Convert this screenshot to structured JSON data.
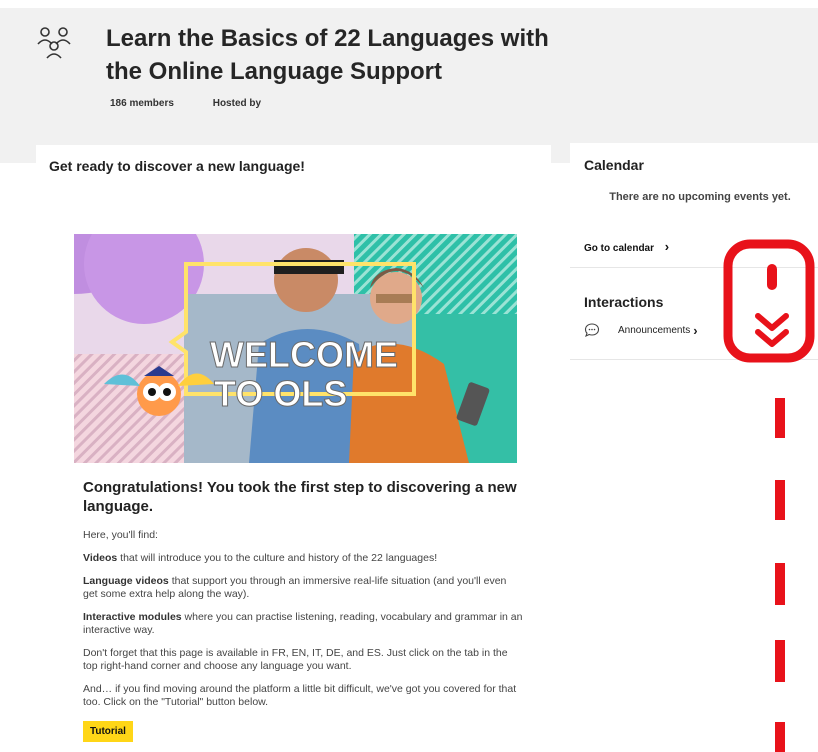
{
  "group": {
    "title": "Learn the Basics of 22 Languages with the Online Language Support",
    "members": "186 members",
    "hosted_by": "Hosted by"
  },
  "main": {
    "title": "Get ready to discover a new language!",
    "banner_text_line1": "WELCOME",
    "banner_text_line2": "TO OLS",
    "heading": "Congratulations! You took the first step to discovering a new language.",
    "intro": "Here, you'll find:",
    "items": [
      {
        "bold": "Videos",
        "text": " that will introduce you to the culture and history of the 22 languages!"
      },
      {
        "bold": "Language videos",
        "text": " that support you through an immersive real-life situation (and you'll even get some extra help along the way)."
      },
      {
        "bold": "Interactive modules",
        "text": " where you can practise listening, reading, vocabulary and grammar in an interactive way."
      }
    ],
    "note1": "Don't forget that this page is available in FR, EN, IT, DE, and ES. Just click on the tab in the top right-hand corner and choose any language you want.",
    "note2": "And… if you find moving around the platform a little bit difficult, we've got you covered for that too. Click on the \"Tutorial\" button below.",
    "tutorial_label": "Tutorial"
  },
  "calendar": {
    "title": "Calendar",
    "empty": "There are no upcoming events yet.",
    "link": "Go to calendar",
    "chevron": "›"
  },
  "interactions": {
    "title": "Interactions",
    "announcements": "Announcements",
    "chevron": "›"
  },
  "icons": {
    "group": "group-icon",
    "chat": "chat-bubble-icon",
    "scroll": "scroll-down-mouse-icon"
  },
  "colors": {
    "accent_yellow": "#ffd617",
    "scroll_red": "#e8121a",
    "header_bg": "#f1f1f1"
  }
}
